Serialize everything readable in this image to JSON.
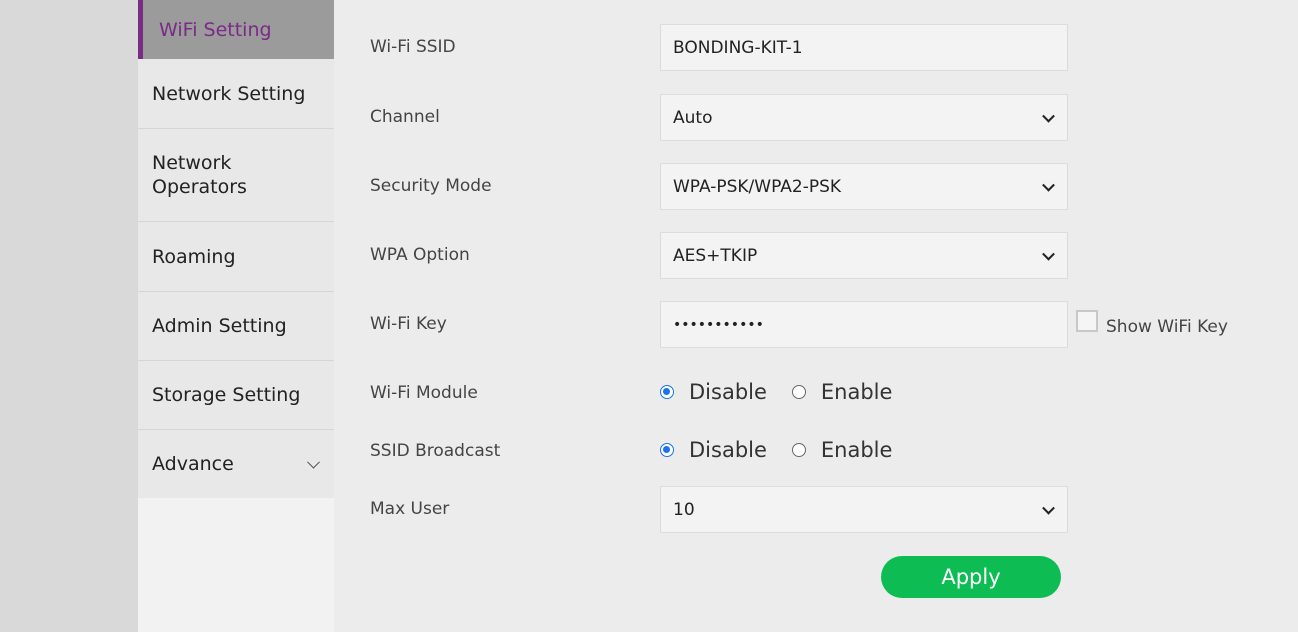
{
  "sidebar": {
    "items": [
      {
        "label": "WiFi Setting",
        "active": true
      },
      {
        "label": "Network Setting"
      },
      {
        "label": "Network Operators"
      },
      {
        "label": "Roaming"
      },
      {
        "label": "Admin Setting"
      },
      {
        "label": "Storage Setting"
      },
      {
        "label": "Advance",
        "icon": "chevron-down-icon"
      }
    ]
  },
  "form": {
    "ssid_label": "Wi-Fi SSID",
    "ssid_value": "BONDING-KIT-1",
    "channel_label": "Channel",
    "channel_value": "Auto",
    "security_label": "Security Mode",
    "security_value": "WPA-PSK/WPA2-PSK",
    "wpa_label": "WPA Option",
    "wpa_value": "AES+TKIP",
    "key_label": "Wi-Fi Key",
    "key_value": "•••••••••••",
    "show_key_label": "Show WiFi Key",
    "show_key_checked": false,
    "module_label": "Wi-Fi Module",
    "module_disable": "Disable",
    "module_enable": "Enable",
    "module_selected": "Disable",
    "broadcast_label": "SSID Broadcast",
    "broadcast_disable": "Disable",
    "broadcast_enable": "Enable",
    "broadcast_selected": "Disable",
    "max_user_label": "Max User",
    "max_user_value": "10",
    "apply_label": "Apply"
  },
  "colors": {
    "accent": "#7a2b86",
    "apply": "#0dbd54",
    "radio": "#1a73e8"
  }
}
